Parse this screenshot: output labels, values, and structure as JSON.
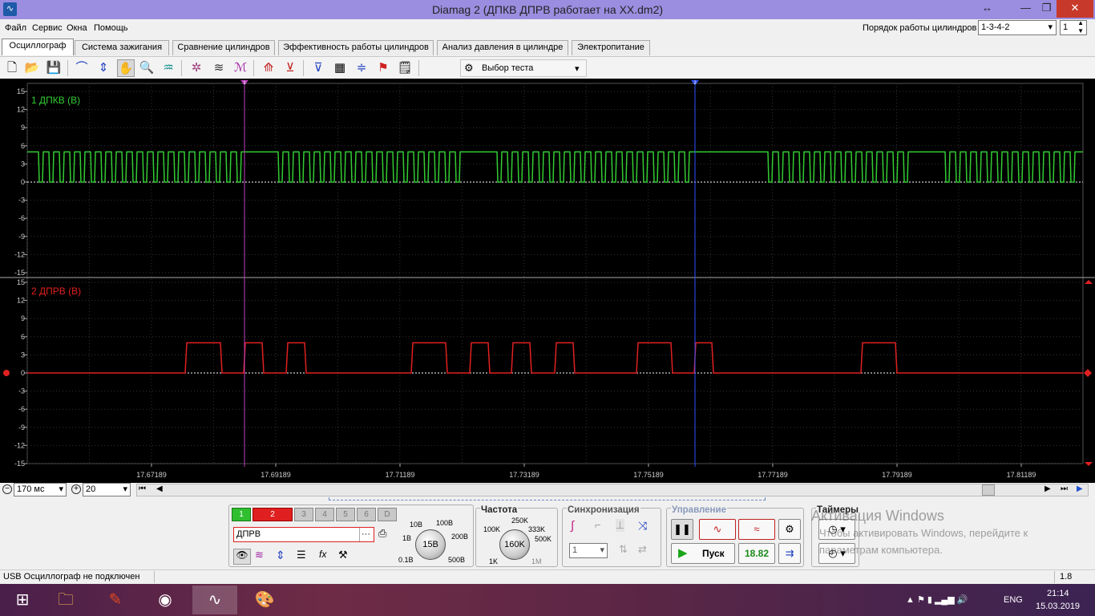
{
  "window": {
    "title": "Diamag 2 (ДПКВ ДПРВ работает на ХХ.dm2)",
    "app_icon": "oscilloscope-icon"
  },
  "menu": [
    "Файл",
    "Сервис",
    "Окна",
    "Помощь"
  ],
  "cylinder_order": {
    "label": "Порядок работы цилиндров",
    "value": "1-3-4-2",
    "number": "1"
  },
  "tabs": [
    "Осциллограф",
    "Система зажигания",
    "Сравнение цилиндров",
    "Эффективность работы цилиндров",
    "Анализ давления в цилиндре",
    "Электропитание"
  ],
  "active_tab": 0,
  "toolbar": {
    "test_select": "Выбор теста"
  },
  "scope": {
    "channel1": {
      "label": "1 ДПКВ (В)",
      "color": "#33cc33",
      "y_ticks": [
        "15",
        "12",
        "9",
        "6",
        "3",
        "0",
        "-3",
        "-6",
        "-9",
        "-12",
        "-15"
      ]
    },
    "channel2": {
      "label": "2 ДПРВ (В)",
      "color": "#e02020",
      "y_ticks": [
        "15",
        "12",
        "9",
        "6",
        "3",
        "0",
        "-3",
        "-6",
        "-9",
        "-12",
        "-15"
      ]
    },
    "x_ticks": [
      "17.67189",
      "17.69189",
      "17.71189",
      "17.73189",
      "17.75189",
      "17.77189",
      "17.79189",
      "17.81189"
    ],
    "cursor1": {
      "label": "1",
      "color": "#c040c0"
    },
    "cursor2": {
      "label": "2",
      "color": "#3050ff"
    },
    "ch2_pulses": [
      [
        231,
        277
      ],
      [
        304,
        329
      ],
      [
        357,
        382
      ],
      [
        513,
        558
      ],
      [
        586,
        611
      ],
      [
        638,
        663
      ],
      [
        692,
        717
      ],
      [
        794,
        839
      ],
      [
        866,
        890
      ],
      [
        1074,
        1119
      ]
    ]
  },
  "subbar": {
    "timebase": "170 мс",
    "zoom": "20"
  },
  "channels_panel": {
    "buttons": [
      "1",
      "2",
      "3",
      "4",
      "5",
      "6",
      "D"
    ],
    "sensor": "ДПРВ",
    "volt_knob": {
      "value": "15В",
      "labels": [
        "10В",
        "100В",
        "1В",
        "200В",
        "0.1В",
        "500В"
      ]
    }
  },
  "frequency_panel": {
    "title": "Частота",
    "value": "160K",
    "labels": [
      "250K",
      "100K",
      "333K",
      "500K",
      "1K",
      "1M"
    ]
  },
  "sync_panel": {
    "title": "Синхронизация",
    "value": "1"
  },
  "control_panel": {
    "title": "Управление",
    "start_label": "Пуск",
    "value": "18.82"
  },
  "timers_panel": {
    "title": "Таймеры"
  },
  "watermark": {
    "line1": "Активация Windows",
    "line2": "Чтобы активировать Windows, перейдите к",
    "line3": "параметрам компьютера."
  },
  "status": {
    "text": "USB Осциллограф не подключен",
    "right": "1.8"
  },
  "taskbar": {
    "lang": "ENG",
    "time": "21:14",
    "date": "15.03.2019"
  }
}
